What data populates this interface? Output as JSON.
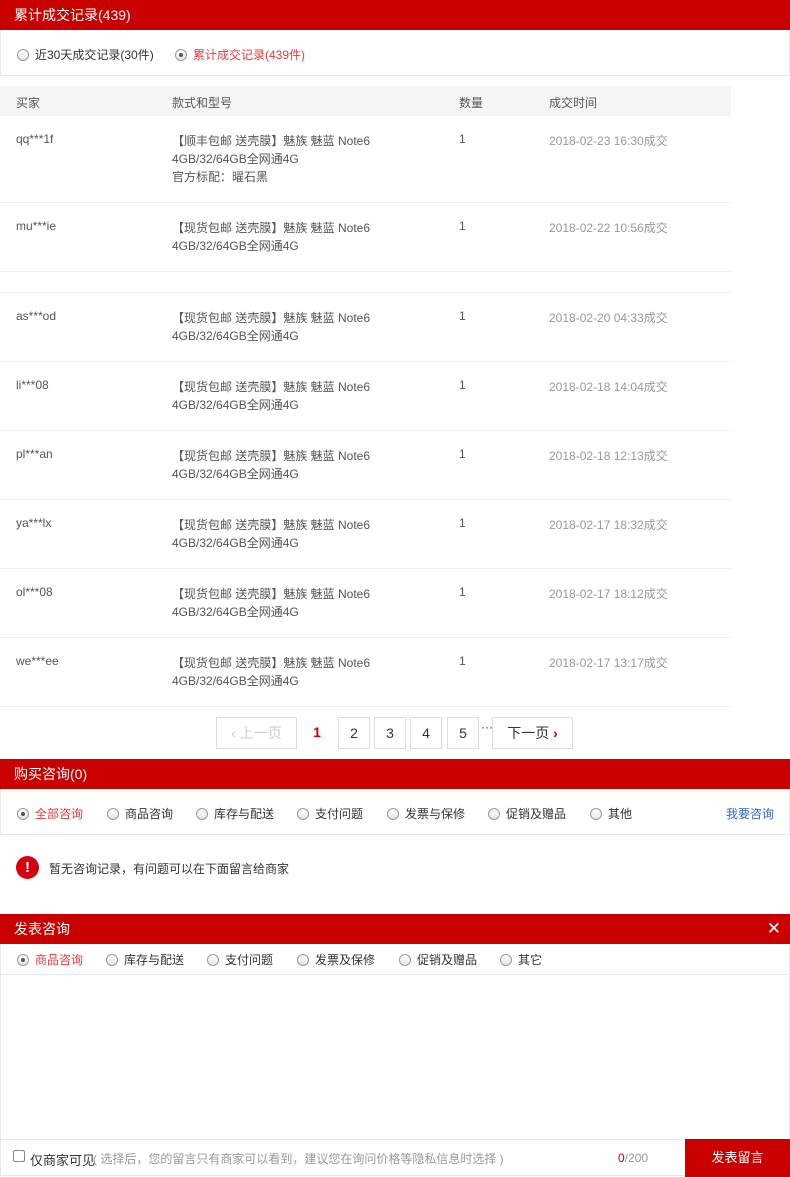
{
  "deals": {
    "title": "累计成交记录(439)",
    "filters": [
      {
        "label": "近30天成交记录(30件)",
        "selected": false
      },
      {
        "label": "累计成交记录(439件)",
        "selected": true
      }
    ],
    "columns": [
      "买家",
      "款式和型号",
      "数量",
      "成交时间"
    ],
    "rows": [
      {
        "buyer": "qq***1f",
        "product": [
          "【顺丰包邮 送壳膜】魅族 魅蓝 Note6",
          "4GB/32/64GB全网通4G",
          "官方标配：曜石黑"
        ],
        "qty": "1",
        "time": "2018-02-23 16:30成交"
      },
      {
        "buyer": "mu***ie",
        "product": [
          "【现货包邮 送壳膜】魅族 魅蓝 Note6",
          "4GB/32/64GB全网通4G"
        ],
        "qty": "1",
        "time": "2018-02-22 10:56成交"
      },
      {
        "buyer": "",
        "product": [],
        "qty": "",
        "time": ""
      },
      {
        "buyer": "as***od",
        "product": [
          "【现货包邮 送壳膜】魅族 魅蓝 Note6",
          "4GB/32/64GB全网通4G"
        ],
        "qty": "1",
        "time": "2018-02-20 04:33成交"
      },
      {
        "buyer": "li***08",
        "product": [
          "【现货包邮 送壳膜】魅族 魅蓝 Note6",
          "4GB/32/64GB全网通4G"
        ],
        "qty": "1",
        "time": "2018-02-18 14:04成交"
      },
      {
        "buyer": "pl***an",
        "product": [
          "【现货包邮 送壳膜】魅族 魅蓝 Note6",
          "4GB/32/64GB全网通4G"
        ],
        "qty": "1",
        "time": "2018-02-18 12:13成交"
      },
      {
        "buyer": "ya***lx",
        "product": [
          "【现货包邮 送壳膜】魅族 魅蓝 Note6",
          "4GB/32/64GB全网通4G"
        ],
        "qty": "1",
        "time": "2018-02-17 18:32成交"
      },
      {
        "buyer": "ol***08",
        "product": [
          "【现货包邮 送壳膜】魅族 魅蓝 Note6",
          "4GB/32/64GB全网通4G"
        ],
        "qty": "1",
        "time": "2018-02-17 18:12成交"
      },
      {
        "buyer": "we***ee",
        "product": [
          "【现货包邮 送壳膜】魅族 魅蓝 Note6",
          "4GB/32/64GB全网通4G"
        ],
        "qty": "1",
        "time": "2018-02-17 13:17成交"
      }
    ]
  },
  "pager": {
    "prev": "上一页",
    "next": "下一页",
    "pages": [
      "1",
      "2",
      "3",
      "4",
      "5"
    ],
    "current": "1",
    "ellipsis": "···"
  },
  "consult": {
    "title": "购买咨询(0)",
    "filters": [
      {
        "label": "全部咨询",
        "selected": true
      },
      {
        "label": "商品咨询",
        "selected": false
      },
      {
        "label": "库存与配送",
        "selected": false
      },
      {
        "label": "支付问题",
        "selected": false
      },
      {
        "label": "发票与保修",
        "selected": false
      },
      {
        "label": "促销及赠品",
        "selected": false
      },
      {
        "label": "其他",
        "selected": false
      }
    ],
    "ask_link": "我要咨询",
    "empty_icon": "!",
    "empty_text": "暂无咨询记录，有问题可以在下面留言给商家"
  },
  "post": {
    "title": "发表咨询",
    "close_glyph": "✕",
    "options": [
      {
        "label": "商品咨询",
        "selected": true
      },
      {
        "label": "库存与配送",
        "selected": false
      },
      {
        "label": "支付问题",
        "selected": false
      },
      {
        "label": "发票及保修",
        "selected": false
      },
      {
        "label": "促销及赠品",
        "selected": false
      },
      {
        "label": "其它",
        "selected": false
      }
    ],
    "private_label": "仅商家可见",
    "private_hint": "( 选择后，您的留言只有商家可以看到，建议您在询问价格等隐私信息时选择 )",
    "count_current": "0",
    "count_max": "/200",
    "submit": "发表留言"
  },
  "colors": {
    "brand": "#c90000",
    "active": "#e4393c",
    "link": "#3366cc"
  }
}
